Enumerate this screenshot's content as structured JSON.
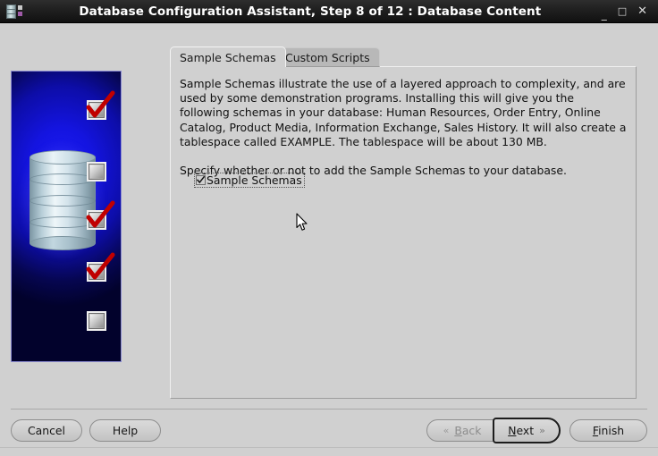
{
  "window": {
    "title": "Database Configuration Assistant, Step 8 of 12 : Database Content",
    "icon": "database-icon",
    "controls": {
      "minimize": "_",
      "maximize": "□",
      "close": "✕"
    }
  },
  "side_graphic": {
    "name": "database-illustration",
    "background_color": "#0d0da8",
    "markers": [
      {
        "state": "checked"
      },
      {
        "state": "unchecked"
      },
      {
        "state": "checked"
      },
      {
        "state": "checked"
      },
      {
        "state": "unchecked"
      }
    ]
  },
  "tabs": [
    {
      "label": "Sample Schemas",
      "active": true
    },
    {
      "label": "Custom Scripts",
      "active": false
    }
  ],
  "content": {
    "paragraph1": "Sample Schemas illustrate the use of a layered approach to complexity, and are used by some demonstration programs. Installing this will give you the following schemas in your database: Human Resources, Order Entry, Online Catalog, Product Media, Information Exchange, Sales History. It will also create a tablespace called EXAMPLE. The tablespace will be about 130 MB.",
    "paragraph2": "Specify whether or not to add the Sample Schemas to your database.",
    "checkbox": {
      "label": "Sample Schemas",
      "checked": true,
      "focused": true
    }
  },
  "buttons": {
    "cancel": "Cancel",
    "help": "Help",
    "back": "Back",
    "back_mnemonic": "B",
    "back_enabled": false,
    "next": "Next",
    "next_mnemonic": "N",
    "next_focused": true,
    "finish": "Finish",
    "finish_mnemonic": "F",
    "back_arrow": "«",
    "next_arrow": "»"
  }
}
